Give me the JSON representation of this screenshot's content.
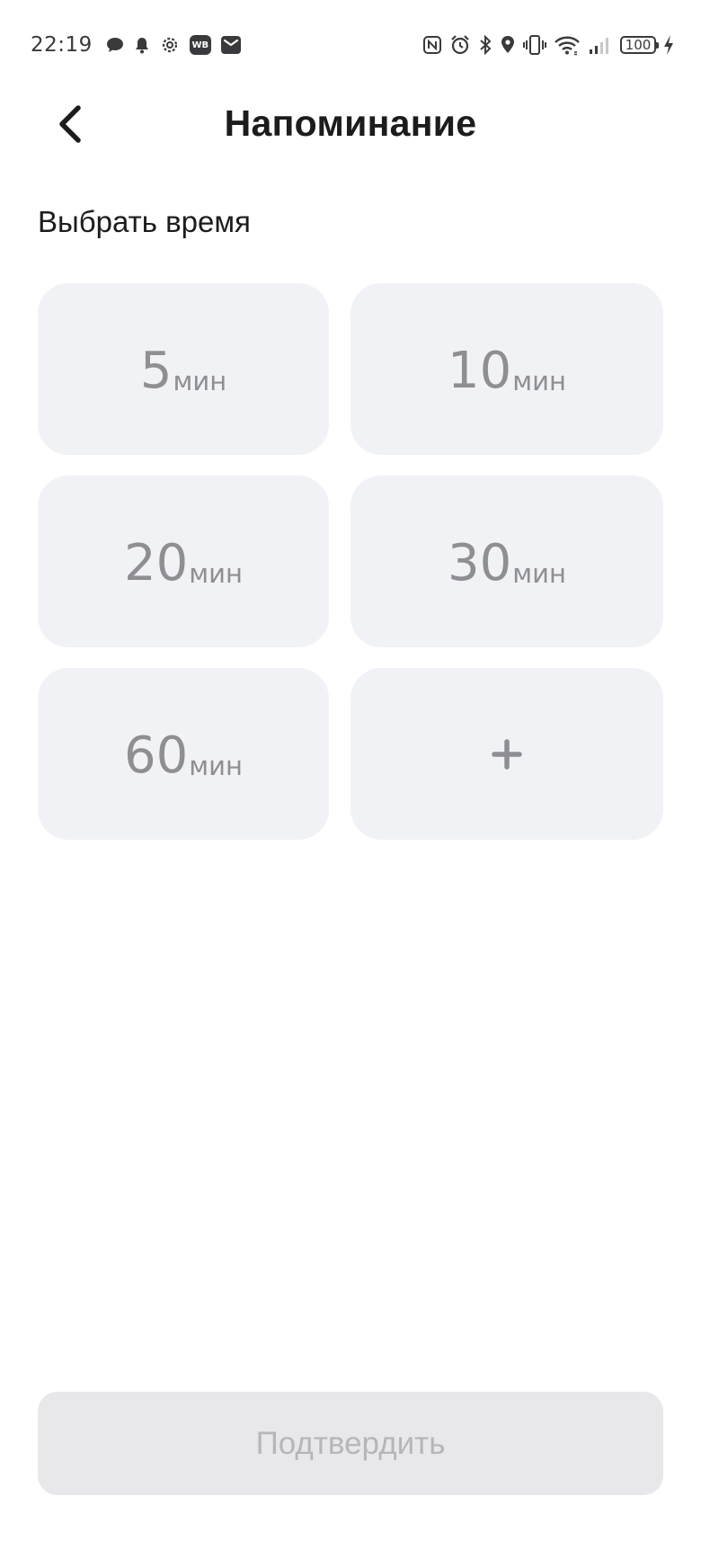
{
  "status_bar": {
    "time": "22:19",
    "battery": "100",
    "left_icons": [
      "chat-bubble-icon",
      "bell-icon",
      "settings-gear-icon",
      "wb-app-icon",
      "mail-icon"
    ],
    "right_icons": [
      "nfc-icon",
      "alarm-icon",
      "bluetooth-icon",
      "location-icon",
      "vibrate-icon",
      "wifi-icon",
      "signal-icon",
      "battery-icon",
      "charging-icon"
    ],
    "wb_label": "WB"
  },
  "header": {
    "title": "Напоминание",
    "back_icon": "chevron-left-icon"
  },
  "section": {
    "label": "Выбрать время"
  },
  "options": [
    {
      "value": "5",
      "unit": "мин"
    },
    {
      "value": "10",
      "unit": "мин"
    },
    {
      "value": "20",
      "unit": "мин"
    },
    {
      "value": "30",
      "unit": "мин"
    },
    {
      "value": "60",
      "unit": "мин"
    }
  ],
  "custom_option": {
    "icon": "plus-icon"
  },
  "confirm": {
    "label": "Подтвердить"
  },
  "colors": {
    "card_background": "#f1f2f6",
    "card_text": "#8e8e93",
    "button_disabled_background": "#e8e8ea",
    "button_disabled_text": "#b6b6ba"
  }
}
